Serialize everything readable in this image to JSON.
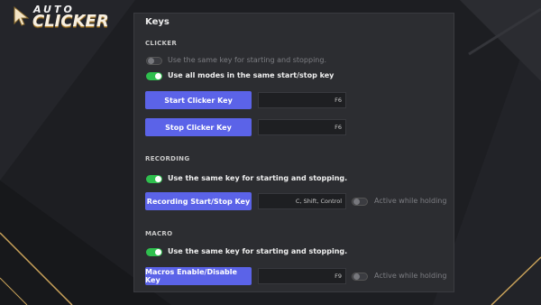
{
  "logo": {
    "line1": "AUTO",
    "line2": "CLICKER"
  },
  "panel": {
    "title": "Keys"
  },
  "clicker": {
    "section": "CLICKER",
    "same_key_label": "Use the same key for starting and stopping.",
    "same_key_on": false,
    "all_modes_label": "Use all modes in the same start/stop key",
    "all_modes_on": true,
    "start_button": "Start Clicker Key",
    "start_key": "F6",
    "stop_button": "Stop Clicker Key",
    "stop_key": "F6"
  },
  "recording": {
    "section": "RECORDING",
    "same_key_label": "Use the same key for starting and stopping.",
    "same_key_on": true,
    "button": "Recording Start/Stop Key",
    "key": "C, Shift, Control",
    "active_label": "Active while holding",
    "active_on": false
  },
  "macro": {
    "section": "MACRO",
    "same_key_label": "Use the same key for starting and stopping.",
    "same_key_on": true,
    "button": "Macros Enable/Disable Key",
    "key": "F9",
    "active_label": "Active while holding",
    "active_on": false
  },
  "colors": {
    "accent": "#5b63e8",
    "toggle_on": "#2fbf4e",
    "panel": "#2c2d31",
    "background": "#1d1e22",
    "gold": "#c9a25a"
  },
  "icons": {
    "logo": "cursor-icon"
  }
}
